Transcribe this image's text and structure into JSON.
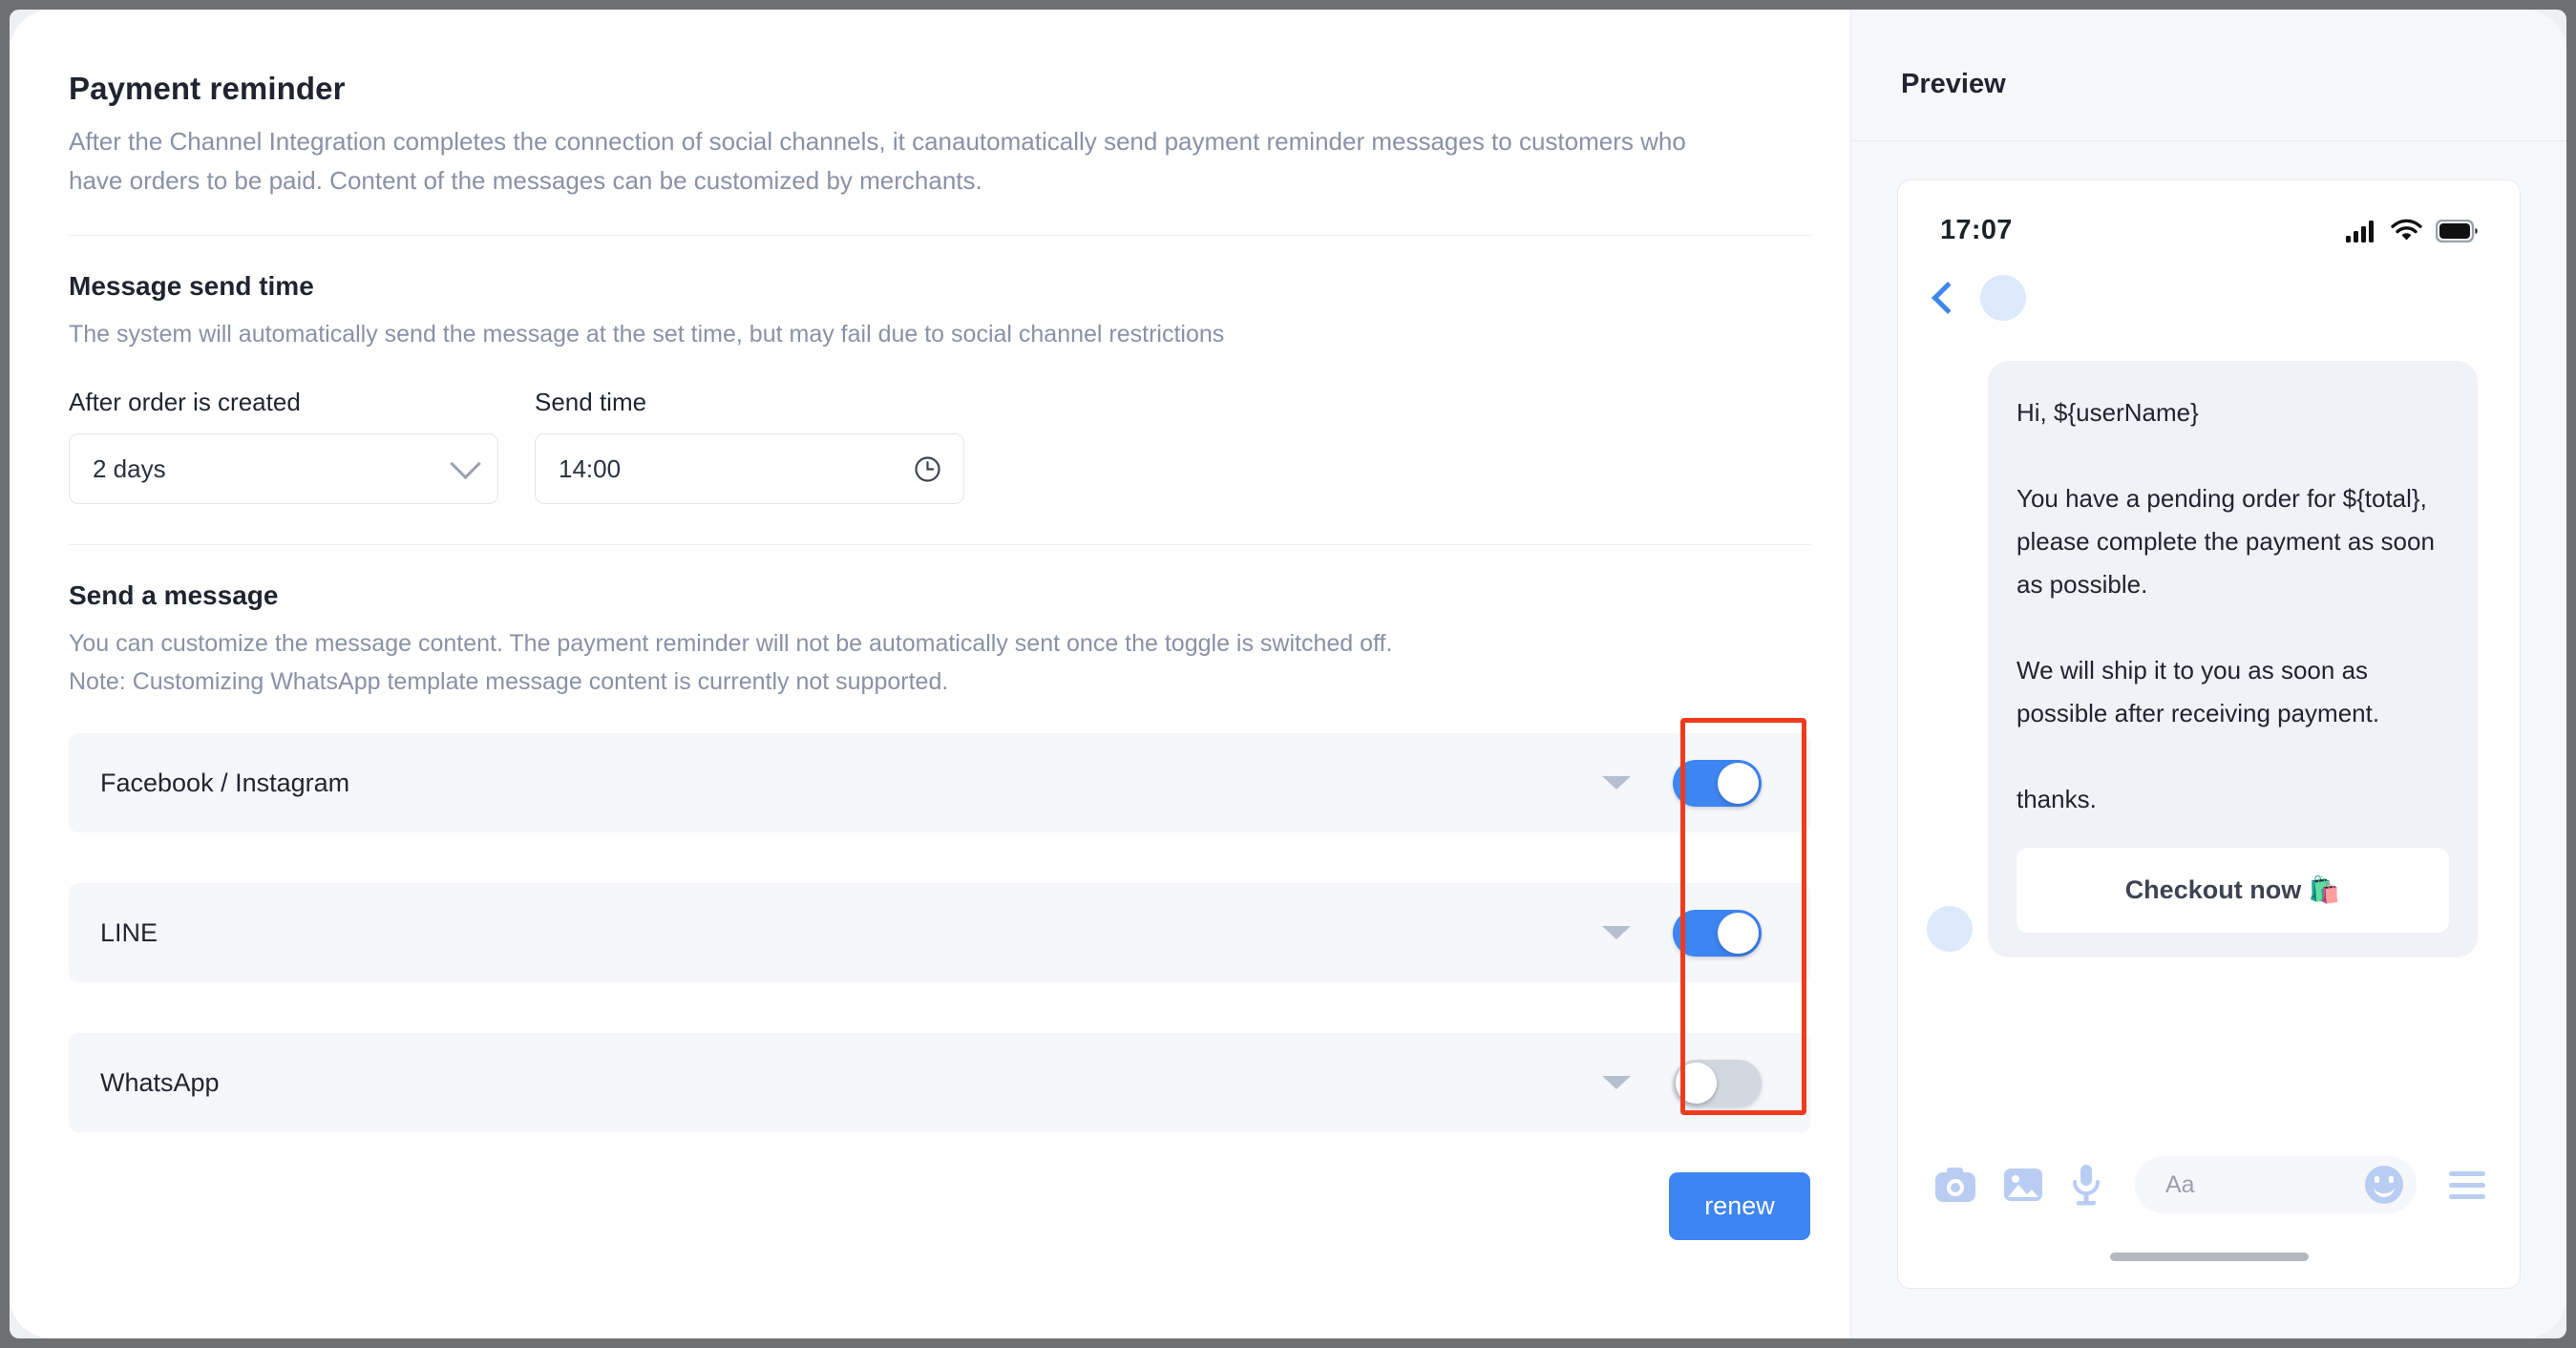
{
  "page": {
    "title": "Payment reminder",
    "description": "After the Channel Integration completes the connection of social channels, it canautomatically send payment reminder messages to customers who have orders to be paid. Content of the messages can be customized by merchants."
  },
  "send_time_section": {
    "title": "Message send time",
    "description": "The system will automatically send the message at the set time, but may fail due to social channel restrictions",
    "delay_label": "After order is created",
    "delay_value": "2 days",
    "time_label": "Send time",
    "time_value": "14:00"
  },
  "message_section": {
    "title": "Send a message",
    "description_line1": "You can customize the message content. The payment reminder will not be automatically sent once the toggle is switched off.",
    "description_line2": "Note: Customizing WhatsApp template message content is currently not supported.",
    "channels": [
      {
        "name": "Facebook / Instagram",
        "enabled": "on"
      },
      {
        "name": "LINE",
        "enabled": "on"
      },
      {
        "name": "WhatsApp",
        "enabled": "off"
      }
    ]
  },
  "actions": {
    "renew_label": "renew"
  },
  "preview": {
    "title": "Preview",
    "status_time": "17:07",
    "message": {
      "greeting": "Hi, ${userName}",
      "body1": "You have a pending order for ${total}, please complete the payment as soon as possible.",
      "body2": "We will ship it to you as soon as possible after receiving payment.",
      "closing": "thanks.",
      "cta_label": "Checkout now 🛍️"
    },
    "composer_placeholder": "Aa"
  },
  "colors": {
    "accent": "#3d85f0",
    "toggle_off": "#d3d7df",
    "annotation": "#ef3b1d",
    "row_bg": "#f6f7fa",
    "muted_text": "#8991a6"
  }
}
